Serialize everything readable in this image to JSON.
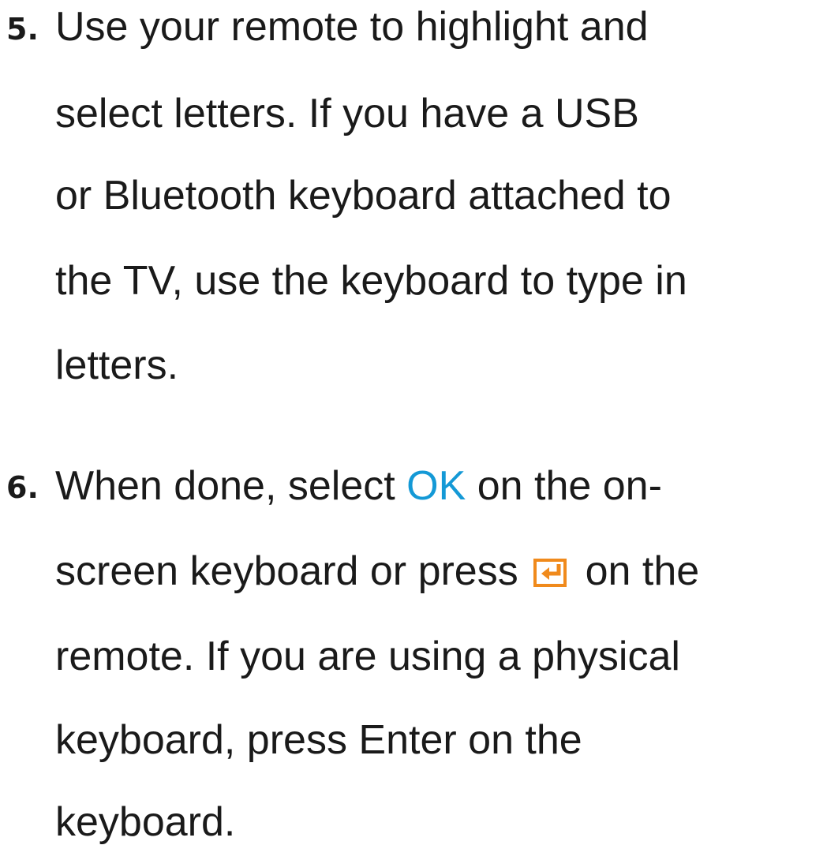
{
  "steps": [
    {
      "number": "5.",
      "lines": [
        "Use your remote to highlight and",
        "select letters. If you have a USB",
        "or Bluetooth keyboard attached to",
        "the TV, use the keyboard to type in",
        "letters."
      ]
    },
    {
      "number": "6.",
      "line1_pre": "When done, select ",
      "line1_highlight": "OK",
      "line1_post": " on the on-",
      "line2_pre": "screen keyboard or press ",
      "line2_icon": "enter-icon",
      "line2_post": " on the",
      "lines_rest": [
        "remote. If you are using a physical",
        "keyboard, press Enter on the",
        "keyboard."
      ]
    }
  ],
  "colors": {
    "highlight": "#1499d6",
    "icon_accent": "#f08a1c",
    "text": "#1a1a1a"
  }
}
